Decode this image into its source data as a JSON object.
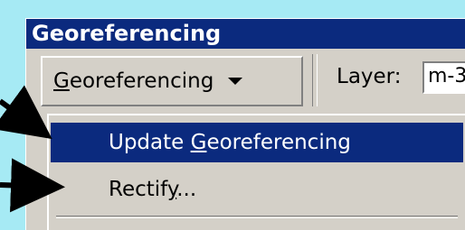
{
  "window": {
    "title": "Georeferencing"
  },
  "toolbar": {
    "georef_menu": {
      "label": "Georeferencing",
      "mnemonic_index": 0
    },
    "layer_label": "Layer:",
    "layer_value": "m-3"
  },
  "menu": {
    "items": [
      {
        "label": "Update Georeferencing",
        "mnemonic_char": "G",
        "highlighted": true
      },
      {
        "label": "Rectify...",
        "mnemonic_char": "y",
        "highlighted": false
      }
    ]
  },
  "colors": {
    "background": "#a6eaf4",
    "title_bar": "#0b2a7e",
    "highlight": "#0b2a7e",
    "window_face": "#d4d0c8",
    "arrow": "#000000"
  },
  "icons": {
    "dropdown": "triangle-down-icon",
    "pointers": "callout-arrow-icon"
  }
}
